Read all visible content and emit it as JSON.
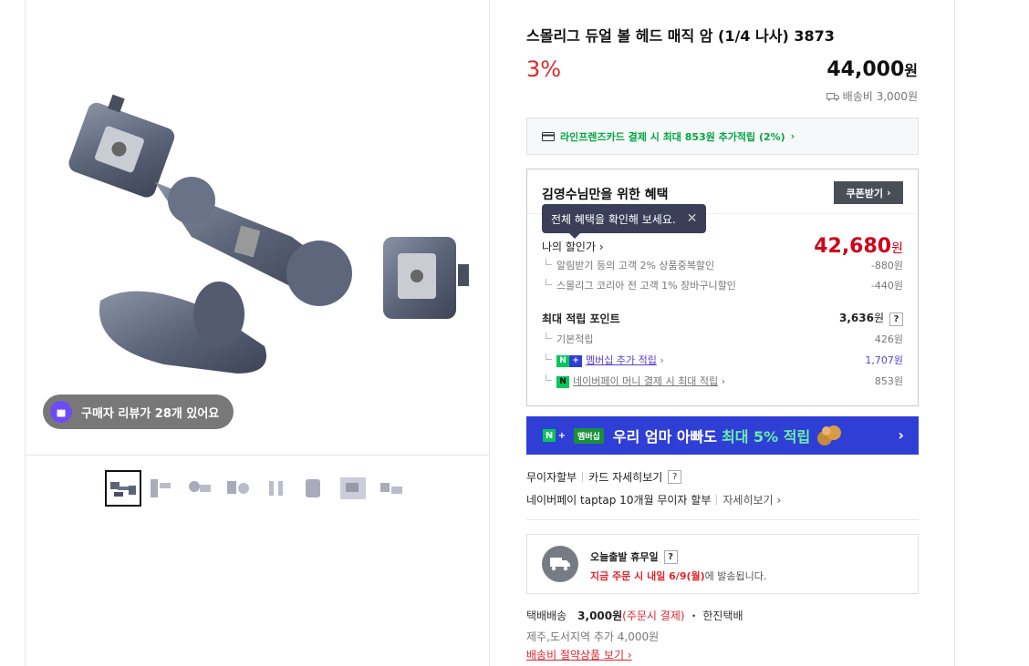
{
  "product": {
    "title": "스몰리그 듀얼 볼 헤드 매직 암 (1/4 나사) 3873",
    "discount_rate": "3%",
    "price_number": "44,000",
    "price_unit": "원",
    "shipping_fee": "배송비 3,000원"
  },
  "gallery": {
    "review_pill": "구매자 리뷰가 28개 있어요",
    "thumbnail_count": 8
  },
  "card_banner": {
    "text": "라인프렌즈카드 결제 시 최대 853원 추가적립 (2%)",
    "arrow": "›"
  },
  "benefits": {
    "title": "김영수님만을 위한 혜택",
    "coupon_button": "쿠폰받기",
    "tooltip": "전체 혜택을 확인해 보세요.",
    "my_discount_label": "나의 할인가",
    "my_discount_price": "42,680",
    "my_discount_unit": "원",
    "discounts": [
      {
        "label": "알림받기 등의 고객 2% 상품중복할인",
        "value": "-880원"
      },
      {
        "label": "스몰리그 코리아 전 고객 1% 장바구니할인",
        "value": "-440원"
      }
    ],
    "points_label": "최대 적립 포인트",
    "points_value": "3,636",
    "points_unit": "원",
    "help": "?",
    "point_rows": [
      {
        "label": "기본적립",
        "value": "426원"
      },
      {
        "label": "멤버십 추가 적립",
        "value": "1,707원"
      },
      {
        "label": "네이버페이 머니 결제 시 최대 적립",
        "value": "853원"
      }
    ]
  },
  "promo": {
    "chip": "멤버십",
    "text": "우리 엄마 아빠도",
    "highlight": "최대 5% 적립"
  },
  "installment": {
    "label": "무이자할부",
    "card_detail": "카드 자세히보기",
    "naverpay": "네이버페이 taptap 10개월 무이자 할부",
    "detail_link": "자세히보기"
  },
  "delivery": {
    "title": "오늘출발 휴무일",
    "desc_red": "지금 주문 시 내일 6/9(월)",
    "desc_rest": "에 발송됩니다."
  },
  "shipping": {
    "label": "택배배송",
    "price": "3,000원",
    "pay": "(주문시 결제)",
    "carrier": "・ 한진택배",
    "extra": "제주,도서지역 추가 4,000원",
    "saving_link": "배송비 절약상품 보기"
  },
  "colors": {
    "discount_red": "#e2262c",
    "naver_green": "#00a843",
    "promo_blue": "#2f3fd6",
    "tooltip_navy": "#3a3f57",
    "member_purple": "#5a3fd2"
  }
}
